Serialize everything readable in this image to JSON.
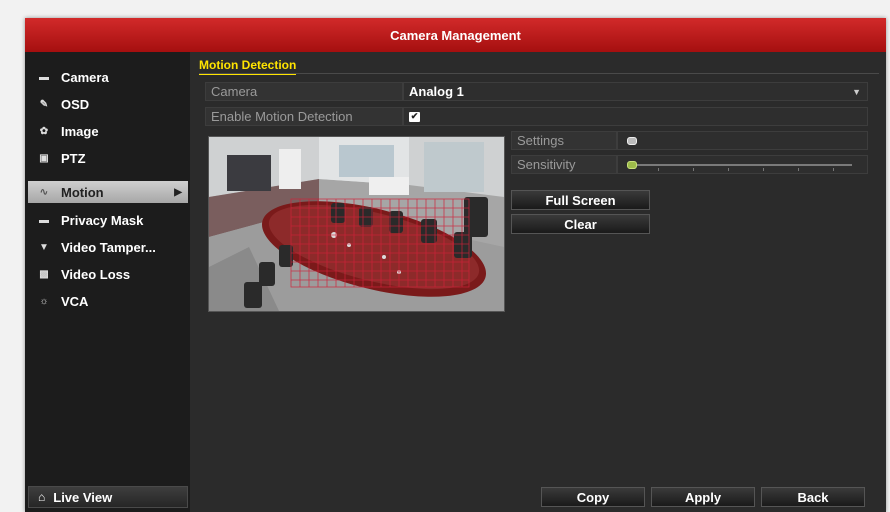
{
  "window": {
    "title": "Camera Management"
  },
  "sidebar": {
    "items": [
      {
        "label": "Camera",
        "icon": "camera-icon"
      },
      {
        "label": "OSD",
        "icon": "osd-icon"
      },
      {
        "label": "Image",
        "icon": "image-icon"
      },
      {
        "label": "PTZ",
        "icon": "ptz-icon"
      },
      {
        "label": "Motion",
        "icon": "motion-icon",
        "active": true
      },
      {
        "label": "Privacy Mask",
        "icon": "privacy-mask-icon"
      },
      {
        "label": "Video Tamper...",
        "icon": "video-tamper-icon"
      },
      {
        "label": "Video Loss",
        "icon": "video-loss-icon"
      },
      {
        "label": "VCA",
        "icon": "vca-icon"
      }
    ],
    "live_view": "Live View"
  },
  "main": {
    "tab": "Motion Detection",
    "camera_label": "Camera",
    "camera_value": "Analog 1",
    "enable_label": "Enable Motion Detection",
    "enable_checked": true,
    "settings_label": "Settings",
    "settings_level": 0.0,
    "sensitivity_label": "Sensitivity",
    "sensitivity_level": 0.0,
    "full_screen": "Full Screen",
    "clear": "Clear"
  },
  "footer": {
    "copy": "Copy",
    "apply": "Apply",
    "back": "Back"
  },
  "colors": {
    "title_red": "#c41c1c",
    "tab_yellow": "#ffe400",
    "motion_grid": "#d0223a"
  }
}
